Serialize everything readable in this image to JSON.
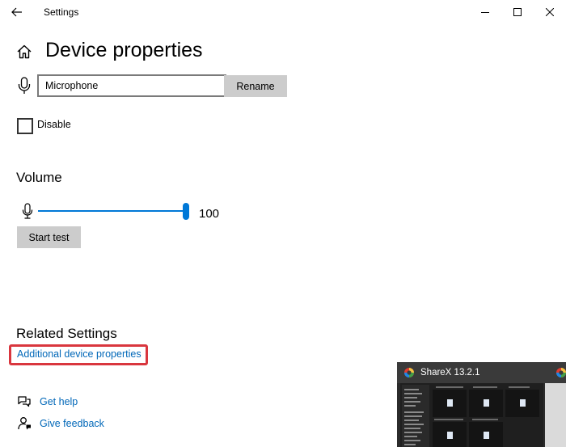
{
  "window": {
    "title": "Settings",
    "back_icon": "arrow-left-icon",
    "controls": [
      "minimize-icon",
      "maximize-icon",
      "close-icon"
    ]
  },
  "header": {
    "title": "Device properties",
    "icon": "home-icon"
  },
  "device": {
    "icon": "microphone-icon",
    "name_value": "Microphone",
    "rename_label": "Rename",
    "disable_label": "Disable",
    "disable_checked": false
  },
  "volume": {
    "heading": "Volume",
    "icon": "microphone-icon",
    "value": "100",
    "level_fraction": 1.0,
    "start_test_label": "Start test",
    "accent": "#0078d7"
  },
  "related": {
    "heading": "Related Settings",
    "link": "Additional device properties",
    "highlight_color": "#d9363e"
  },
  "help": {
    "get_help": "Get help",
    "give_feedback": "Give feedback",
    "link_color": "#0067b8"
  },
  "taskbar_preview": {
    "title": "ShareX 13.2.1"
  }
}
